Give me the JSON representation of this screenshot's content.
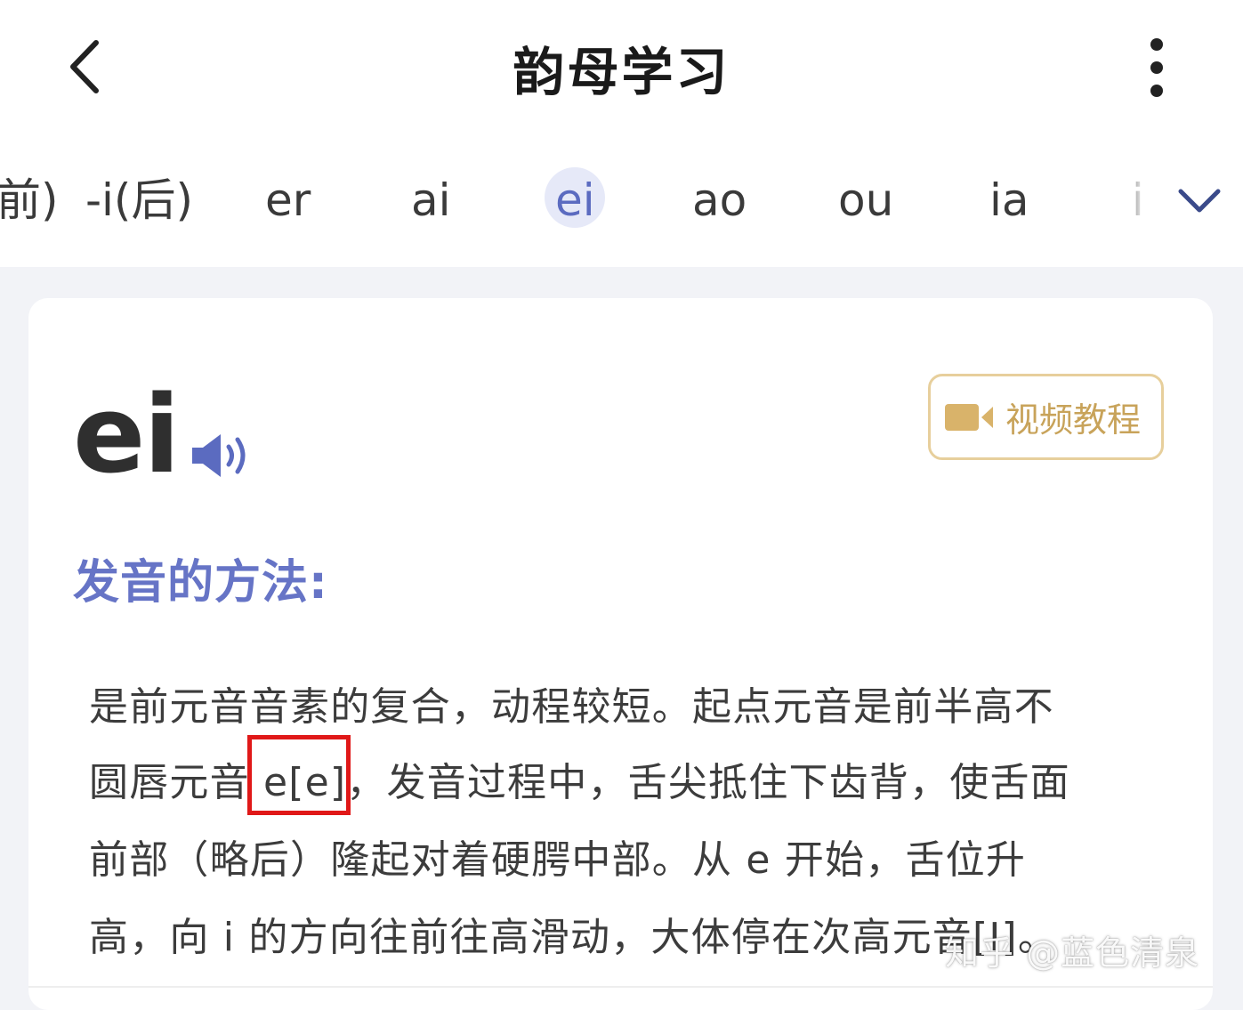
{
  "header": {
    "title": "韵母学习"
  },
  "tabs": [
    {
      "label": "前)",
      "active": false
    },
    {
      "label": "-i(后)",
      "active": false
    },
    {
      "label": "er",
      "active": false
    },
    {
      "label": "ai",
      "active": false
    },
    {
      "label": "ei",
      "active": true
    },
    {
      "label": "ao",
      "active": false
    },
    {
      "label": "ou",
      "active": false
    },
    {
      "label": "ia",
      "active": false
    },
    {
      "label": "ie",
      "active": false
    }
  ],
  "lesson": {
    "letter": "ei",
    "video_button": "视频教程",
    "section_title": "发音的方法:",
    "paragraph_lines": [
      "是前元音音素的复合，动程较短。起点元音是前半高不",
      "圆唇元音 e[e]，发音过程中，舌尖抵住下齿背，使舌面",
      "前部（略后）隆起对着硬腭中部。从 e 开始，舌位升",
      "高，向 i 的方向往前往高滑动，大体停在次高元音[I]。"
    ]
  },
  "watermark": "知乎 @蓝色清泉",
  "colors": {
    "accent": "#5b6bc0",
    "section_title": "#6674c6",
    "gold": "#c8a35a",
    "highlight": "#e01818",
    "page_bg": "#f2f3f7"
  },
  "icons": {
    "back": "chevron-left-icon",
    "more": "more-vertical-icon",
    "expand": "chevron-down-icon",
    "speaker": "speaker-icon",
    "video": "video-camera-icon"
  }
}
